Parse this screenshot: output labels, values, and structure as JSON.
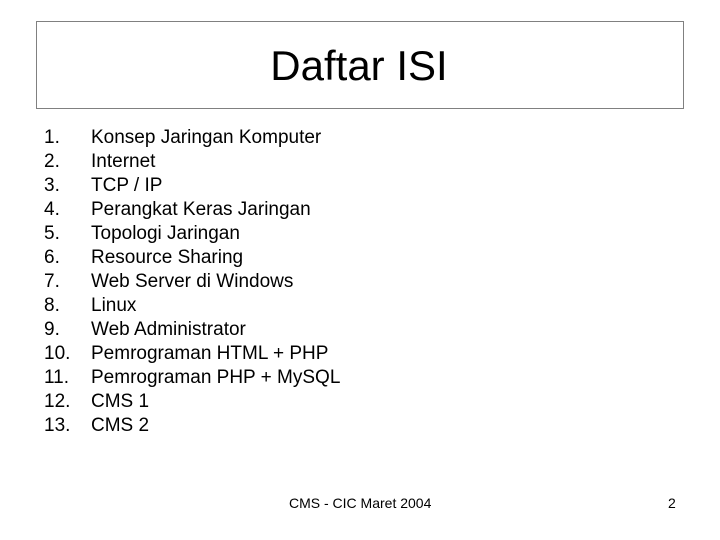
{
  "slide": {
    "title": "Daftar ISI",
    "items": [
      {
        "num": "1.",
        "label": "Konsep Jaringan Komputer"
      },
      {
        "num": "2.",
        "label": "Internet"
      },
      {
        "num": "3.",
        "label": "TCP / IP"
      },
      {
        "num": "4.",
        "label": "Perangkat Keras Jaringan"
      },
      {
        "num": "5.",
        "label": "Topologi Jaringan"
      },
      {
        "num": "6.",
        "label": "Resource Sharing"
      },
      {
        "num": "7.",
        "label": "Web Server di Windows"
      },
      {
        "num": "8.",
        "label": "Linux"
      },
      {
        "num": "9.",
        "label": "Web Administrator"
      },
      {
        "num": "10.",
        "label": "Pemrograman HTML + PHP"
      },
      {
        "num": "11.",
        "label": "Pemrograman PHP + MySQL"
      },
      {
        "num": "12.",
        "label": "CMS 1"
      },
      {
        "num": "13.",
        "label": "CMS 2"
      }
    ],
    "footer": "CMS - CIC Maret 2004",
    "page_number": "2"
  }
}
